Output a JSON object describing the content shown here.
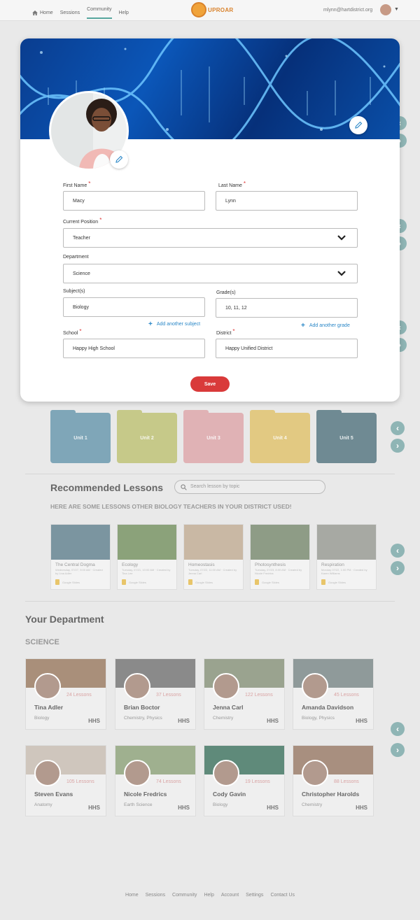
{
  "nav": {
    "items": [
      {
        "label": "Home"
      },
      {
        "label": "Sessions"
      },
      {
        "label": "Community"
      },
      {
        "label": "Help"
      }
    ],
    "logo_text": "UPROAR",
    "user_email": "mlynn@hartdistrict.org"
  },
  "units": [
    {
      "label": "Unit 1",
      "color": "#7fa6b8"
    },
    {
      "label": "Unit 2",
      "color": "#c6c989"
    },
    {
      "label": "Unit 3",
      "color": "#e0b2b5"
    },
    {
      "label": "Unit 4",
      "color": "#e2c982"
    },
    {
      "label": "Unit 5",
      "color": "#6f8a93"
    }
  ],
  "recommended": {
    "title": "Recommended Lessons",
    "search_placeholder": "Search lesson by topic",
    "subtitle": "HERE ARE SOME LESSONS OTHER BIOLOGY TEACHERS IN YOUR DISTRICT USED!",
    "lessons": [
      {
        "name": "The Central Dogma",
        "meta": "Wednesday, 07/27, 9:00 AM · Created by Lina Adler",
        "doc": "Google Slides",
        "color": "#7b95a0"
      },
      {
        "name": "Ecology",
        "meta": "Tuesday, 07/21, 10:00 AM · Created by Tina Lee",
        "doc": "Google Slides",
        "color": "#8ba27a"
      },
      {
        "name": "Homeostasis",
        "meta": "Tuesday, 07/22, 11:00 AM · Created by Jenna Carl",
        "doc": "Google Slides",
        "color": "#c9b8a4"
      },
      {
        "name": "Photosynthesis",
        "meta": "Tuesday, 07/23, 8:00 AM · Created by Nicole Fredrics",
        "doc": "Google Slides",
        "color": "#8e9c86"
      },
      {
        "name": "Respiration",
        "meta": "Monday 07/22, 1:00 PM · Created by Karen Williams",
        "doc": "Google Slides",
        "color": "#a7a9a3"
      }
    ]
  },
  "department": {
    "title": "Your Department",
    "subtitle": "SCIENCE",
    "people": [
      {
        "name": "Tina Adler",
        "subject": "Biology",
        "lessons": "24 Lessons",
        "school": "HHS",
        "banner": "#a98f7a"
      },
      {
        "name": "Brian Boctor",
        "subject": "Chemistry, Physics",
        "lessons": "37 Lessons",
        "school": "HHS",
        "banner": "#8a8a8a"
      },
      {
        "name": "Jenna Carl",
        "subject": "Chemistry",
        "lessons": "122 Lessons",
        "school": "HHS",
        "banner": "#9aa38f"
      },
      {
        "name": "Amanda Davidson",
        "subject": "Biology, Physics",
        "lessons": "45 Lessons",
        "school": "HHS",
        "banner": "#8f9a9a"
      },
      {
        "name": "Steven Evans",
        "subject": "Anatomy",
        "lessons": "105 Lessons",
        "school": "HHS",
        "banner": "#cfc6bd"
      },
      {
        "name": "Nicole Fredrics",
        "subject": "Earth Science",
        "lessons": "74 Lessons",
        "school": "HHS",
        "banner": "#9fb08f"
      },
      {
        "name": "Cody Gavin",
        "subject": "Biology",
        "lessons": "19 Lessons",
        "school": "HHS",
        "banner": "#5f8a7a"
      },
      {
        "name": "Christopher Harolds",
        "subject": "Chemistry",
        "lessons": "88 Lessons",
        "school": "HHS",
        "banner": "#a88f7f"
      }
    ]
  },
  "footer": {
    "links": [
      {
        "label": "Home"
      },
      {
        "label": "Sessions"
      },
      {
        "label": "Community"
      },
      {
        "label": "Help"
      },
      {
        "label": "Account"
      },
      {
        "label": "Settings"
      },
      {
        "label": "Contact Us"
      }
    ]
  },
  "form": {
    "first_name": {
      "label": "First Name",
      "value": "Macy"
    },
    "last_name": {
      "label": "Last Name",
      "value": "Lynn"
    },
    "position": {
      "label": "Current Position",
      "value": "Teacher"
    },
    "department": {
      "label": "Department",
      "value": "Science"
    },
    "subjects": {
      "label": "Subject(s)",
      "value": "Biology",
      "add_label": "Add another subject"
    },
    "grades": {
      "label": "Grade(s)",
      "value": "10, 11, 12",
      "add_label": "Add another grade"
    },
    "school": {
      "label": "School",
      "value": "Happy High School"
    },
    "district": {
      "label": "District",
      "value": "Happy Unified District"
    },
    "save_label": "Save"
  },
  "colors": {
    "accent_red": "#d93a3a",
    "link_blue": "#2a87c7",
    "teal_arrow": "#8fb5b5"
  }
}
